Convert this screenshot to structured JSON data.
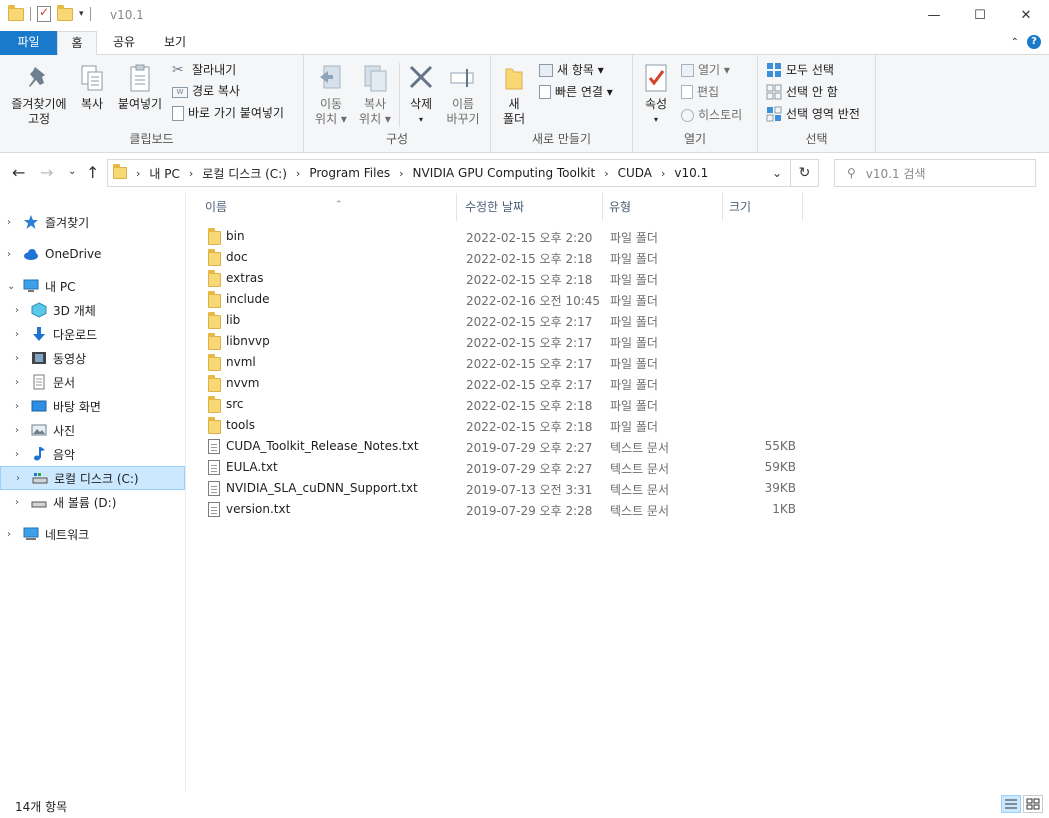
{
  "window": {
    "title": "v10.1",
    "minimize_icon": "minimize-icon",
    "maximize_icon": "maximize-icon",
    "close_icon": "close-icon"
  },
  "ribbon_tabs": [
    "파일",
    "홈",
    "공유",
    "보기"
  ],
  "ribbon": {
    "clipboard": {
      "label": "클립보드",
      "pin": "즐겨찾기에\n고정",
      "copy": "복사",
      "paste": "붙여넣기",
      "cut": "잘라내기",
      "copy_path": "경로 복사",
      "paste_shortcut": "바로 가기 붙여넣기"
    },
    "organize": {
      "label": "구성",
      "move_to": "이동\n위치 ▾",
      "copy_to": "복사\n위치 ▾",
      "delete": "삭제",
      "rename": "이름\n바꾸기"
    },
    "new": {
      "label": "새로 만들기",
      "new_folder": "새\n폴더",
      "new_item": "새 항목 ▾",
      "easy_access": "빠른 연결 ▾"
    },
    "open": {
      "label": "열기",
      "properties": "속성",
      "open": "열기 ▾",
      "edit": "편집",
      "history": "히스토리"
    },
    "select": {
      "label": "선택",
      "select_all": "모두 선택",
      "select_none": "선택 안 함",
      "invert": "선택 영역 반전"
    }
  },
  "address": {
    "crumbs": [
      "내 PC",
      "로컬 디스크 (C:)",
      "Program Files",
      "NVIDIA GPU Computing Toolkit",
      "CUDA",
      "v10.1"
    ],
    "search_placeholder": "v10.1 검색"
  },
  "nav_pane": {
    "items": [
      {
        "label": "즐겨찾기",
        "icon": "star-icon"
      },
      {
        "label": "OneDrive",
        "icon": "cloud-icon"
      },
      {
        "label": "내 PC",
        "icon": "pc-icon"
      },
      {
        "label": "3D 개체",
        "icon": "cube-icon"
      },
      {
        "label": "다운로드",
        "icon": "download-icon"
      },
      {
        "label": "동영상",
        "icon": "video-icon"
      },
      {
        "label": "문서",
        "icon": "document-icon"
      },
      {
        "label": "바탕 화면",
        "icon": "desktop-icon"
      },
      {
        "label": "사진",
        "icon": "picture-icon"
      },
      {
        "label": "음악",
        "icon": "music-icon"
      },
      {
        "label": "로컬 디스크 (C:)",
        "icon": "drive-icon"
      },
      {
        "label": "새 볼륨 (D:)",
        "icon": "drive-icon"
      },
      {
        "label": "네트워크",
        "icon": "network-icon"
      }
    ]
  },
  "columns": [
    "이름",
    "수정한 날짜",
    "유형",
    "크기"
  ],
  "files": [
    {
      "name": "bin",
      "date": "2022-02-15 오후 2:20",
      "type": "파일 폴더",
      "size": "",
      "kind": "folder"
    },
    {
      "name": "doc",
      "date": "2022-02-15 오후 2:18",
      "type": "파일 폴더",
      "size": "",
      "kind": "folder"
    },
    {
      "name": "extras",
      "date": "2022-02-15 오후 2:18",
      "type": "파일 폴더",
      "size": "",
      "kind": "folder"
    },
    {
      "name": "include",
      "date": "2022-02-16 오전 10:45",
      "type": "파일 폴더",
      "size": "",
      "kind": "folder"
    },
    {
      "name": "lib",
      "date": "2022-02-15 오후 2:17",
      "type": "파일 폴더",
      "size": "",
      "kind": "folder"
    },
    {
      "name": "libnvvp",
      "date": "2022-02-15 오후 2:17",
      "type": "파일 폴더",
      "size": "",
      "kind": "folder"
    },
    {
      "name": "nvml",
      "date": "2022-02-15 오후 2:17",
      "type": "파일 폴더",
      "size": "",
      "kind": "folder"
    },
    {
      "name": "nvvm",
      "date": "2022-02-15 오후 2:17",
      "type": "파일 폴더",
      "size": "",
      "kind": "folder"
    },
    {
      "name": "src",
      "date": "2022-02-15 오후 2:18",
      "type": "파일 폴더",
      "size": "",
      "kind": "folder"
    },
    {
      "name": "tools",
      "date": "2022-02-15 오후 2:18",
      "type": "파일 폴더",
      "size": "",
      "kind": "folder"
    },
    {
      "name": "CUDA_Toolkit_Release_Notes.txt",
      "date": "2019-07-29 오후 2:27",
      "type": "텍스트 문서",
      "size": "55KB",
      "kind": "text"
    },
    {
      "name": "EULA.txt",
      "date": "2019-07-29 오후 2:27",
      "type": "텍스트 문서",
      "size": "59KB",
      "kind": "text"
    },
    {
      "name": "NVIDIA_SLA_cuDNN_Support.txt",
      "date": "2019-07-13 오전 3:31",
      "type": "텍스트 문서",
      "size": "39KB",
      "kind": "text"
    },
    {
      "name": "version.txt",
      "date": "2019-07-29 오후 2:28",
      "type": "텍스트 문서",
      "size": "1KB",
      "kind": "text"
    }
  ],
  "status": {
    "item_count": "14개 항목"
  },
  "colors": {
    "accent": "#1979ca",
    "selection": "#cce8ff",
    "folder": "#f8d775"
  }
}
